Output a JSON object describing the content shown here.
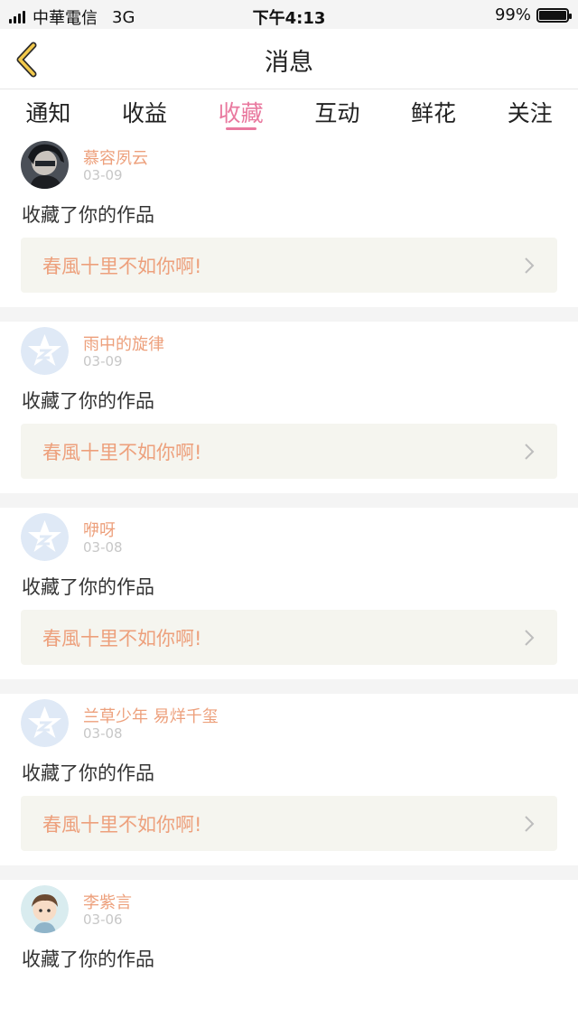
{
  "status_bar": {
    "carrier": "中華電信",
    "network": "3G",
    "time": "下午4:13",
    "battery_text": "99%",
    "battery_level": 0.99
  },
  "nav": {
    "title": "消息",
    "back_icon": "chevron-left-icon",
    "accent": "#f2c94c"
  },
  "tabs": [
    {
      "label": "通知",
      "active": false
    },
    {
      "label": "收益",
      "active": false
    },
    {
      "label": "收藏",
      "active": true
    },
    {
      "label": "互动",
      "active": false
    },
    {
      "label": "鲜花",
      "active": false
    },
    {
      "label": "关注",
      "active": false
    }
  ],
  "colors": {
    "active_tab": "#e9799f",
    "username": "#eda07c",
    "link_bg": "#f5f5ef"
  },
  "notifications": [
    {
      "user": "慕容夙云",
      "date": "03-09",
      "action": "收藏了你的作品",
      "work": "春風十里不如你啊!",
      "avatar": "photo-avatar-dark"
    },
    {
      "user": "雨中的旋律",
      "date": "03-09",
      "action": "收藏了你的作品",
      "work": "春風十里不如你啊!",
      "avatar": "default-star-avatar"
    },
    {
      "user": "咿呀",
      "date": "03-08",
      "action": "收藏了你的作品",
      "work": "春風十里不如你啊!",
      "avatar": "default-star-avatar"
    },
    {
      "user": "兰草少年 易烊千玺",
      "date": "03-08",
      "action": "收藏了你的作品",
      "work": "春風十里不如你啊!",
      "avatar": "default-star-avatar"
    },
    {
      "user": "李紫言",
      "date": "03-06",
      "action": "收藏了你的作品",
      "work": "",
      "avatar": "cartoon-avatar"
    }
  ]
}
